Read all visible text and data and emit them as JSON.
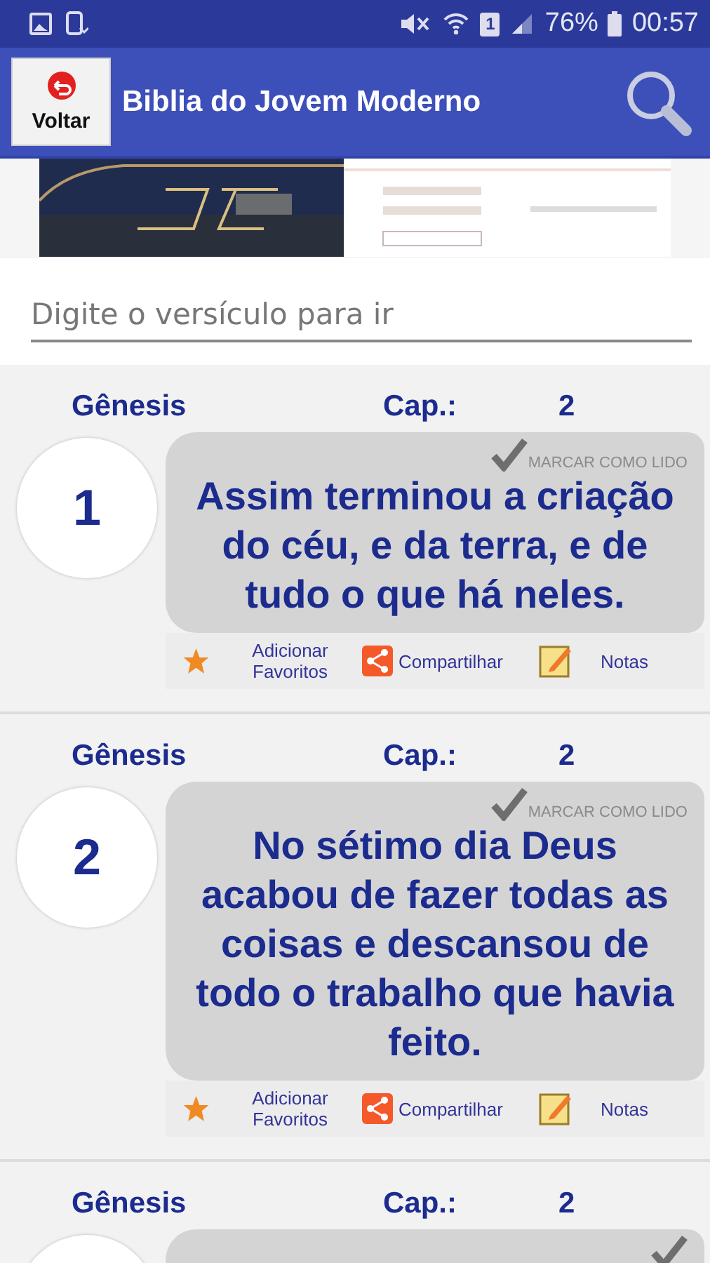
{
  "status_bar": {
    "sim_slot": "1",
    "battery": "76%",
    "time": "00:57"
  },
  "app_bar": {
    "back_label": "Voltar",
    "title": "Biblia do Jovem Moderno"
  },
  "search": {
    "placeholder": "Digite o versículo para ir"
  },
  "verses": [
    {
      "book": "Gênesis",
      "chapter_label": "Cap.:",
      "chapter": "2",
      "number": "1",
      "mark_label": "MARCAR COMO LIDO",
      "text": "Assim terminou a criação do céu, e da terra, e de tudo o que há neles.",
      "actions": [
        {
          "kind": "favorite",
          "label": "Adicionar Favoritos"
        },
        {
          "kind": "share",
          "label": "Compartilhar"
        },
        {
          "kind": "notes",
          "label": "Notas"
        }
      ]
    },
    {
      "book": "Gênesis",
      "chapter_label": "Cap.:",
      "chapter": "2",
      "number": "2",
      "mark_label": "MARCAR COMO LIDO",
      "text": "No sétimo dia Deus acabou de fazer todas as coisas e descansou de todo o trabalho que havia feito.",
      "actions": [
        {
          "kind": "favorite",
          "label": "Adicionar Favoritos"
        },
        {
          "kind": "share",
          "label": "Compartilhar"
        },
        {
          "kind": "notes",
          "label": "Notas"
        }
      ]
    },
    {
      "book": "Gênesis",
      "chapter_label": "Cap.:",
      "chapter": "2"
    }
  ]
}
